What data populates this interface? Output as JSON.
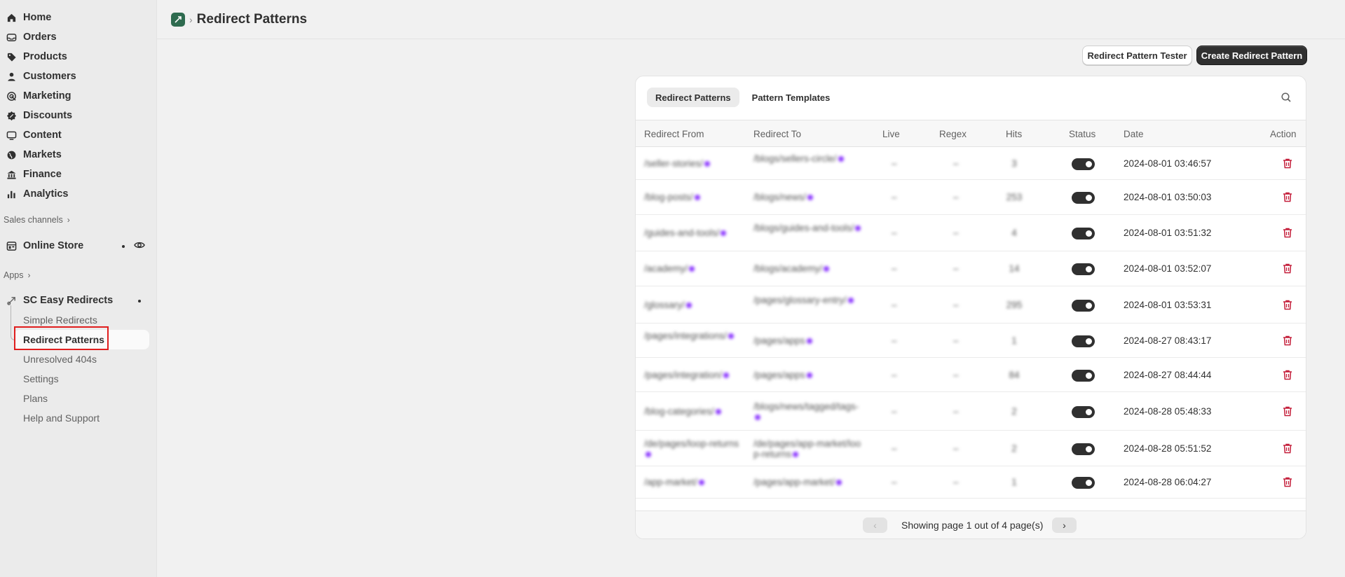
{
  "sidebar": {
    "nav": [
      {
        "label": "Home",
        "icon": "home-icon"
      },
      {
        "label": "Orders",
        "icon": "orders-icon"
      },
      {
        "label": "Products",
        "icon": "tag-icon"
      },
      {
        "label": "Customers",
        "icon": "person-icon"
      },
      {
        "label": "Marketing",
        "icon": "target-icon"
      },
      {
        "label": "Discounts",
        "icon": "discount-icon"
      },
      {
        "label": "Content",
        "icon": "content-icon"
      },
      {
        "label": "Markets",
        "icon": "globe-icon"
      },
      {
        "label": "Finance",
        "icon": "bank-icon"
      },
      {
        "label": "Analytics",
        "icon": "bar-chart-icon"
      }
    ],
    "sales_channels_label": "Sales channels",
    "online_store_label": "Online Store",
    "apps_label": "Apps",
    "app_name": "SC Easy Redirects",
    "app_subnav": [
      "Simple Redirects",
      "Redirect Patterns",
      "Unresolved 404s",
      "Settings",
      "Plans",
      "Help and Support"
    ],
    "active_subnav": "Redirect Patterns"
  },
  "header": {
    "title": "Redirect Patterns"
  },
  "actions": {
    "tester_label": "Redirect Pattern Tester",
    "create_label": "Create Redirect Pattern"
  },
  "tabs": [
    "Redirect Patterns",
    "Pattern Templates"
  ],
  "table": {
    "columns": [
      "Redirect From",
      "Redirect To",
      "Live",
      "Regex",
      "Hits",
      "Status",
      "Date",
      "Action"
    ],
    "rows": [
      {
        "from": "/seller-stories/",
        "to": "/blogs/sellers-circle/",
        "live": "–",
        "regex": "–",
        "hits": "3",
        "date": "2024-08-01 03:46:57"
      },
      {
        "from": "/blog-posts/",
        "to": "/blogs/news/",
        "live": "–",
        "regex": "–",
        "hits": "253",
        "date": "2024-08-01 03:50:03"
      },
      {
        "from": "/guides-and-tools/",
        "to": "/blogs/guides-and-tools/",
        "live": "–",
        "regex": "–",
        "hits": "4",
        "date": "2024-08-01 03:51:32"
      },
      {
        "from": "/academy/",
        "to": "/blogs/academy/",
        "live": "–",
        "regex": "–",
        "hits": "14",
        "date": "2024-08-01 03:52:07"
      },
      {
        "from": "/glossary/",
        "to": "/pages/glossary-entry/",
        "live": "–",
        "regex": "–",
        "hits": "295",
        "date": "2024-08-01 03:53:31"
      },
      {
        "from": "/pages/integrations/",
        "to": "/pages/apps",
        "live": "–",
        "regex": "–",
        "hits": "1",
        "date": "2024-08-27 08:43:17"
      },
      {
        "from": "/pages/integration/",
        "to": "/pages/apps",
        "live": "–",
        "regex": "–",
        "hits": "84",
        "date": "2024-08-27 08:44:44"
      },
      {
        "from": "/blog-categories/",
        "to": "/blogs/news/tagged/tags-",
        "live": "–",
        "regex": "–",
        "hits": "2",
        "date": "2024-08-28 05:48:33"
      },
      {
        "from": "/de/pages/loop-returns",
        "to": "/de/pages/app-market/loop-returns",
        "live": "–",
        "regex": "–",
        "hits": "2",
        "date": "2024-08-28 05:51:52"
      },
      {
        "from": "/app-market/",
        "to": "/pages/app-market/",
        "live": "–",
        "regex": "–",
        "hits": "1",
        "date": "2024-08-28 06:04:27"
      }
    ]
  },
  "pagination": {
    "text": "Showing page 1 out of 4 page(s)",
    "prev": "‹",
    "next": "›"
  },
  "colors": {
    "accent_dark": "#303030",
    "danger": "#c41e3a",
    "highlight": "#e01e1e",
    "purple_dot": "#8e3bff"
  }
}
